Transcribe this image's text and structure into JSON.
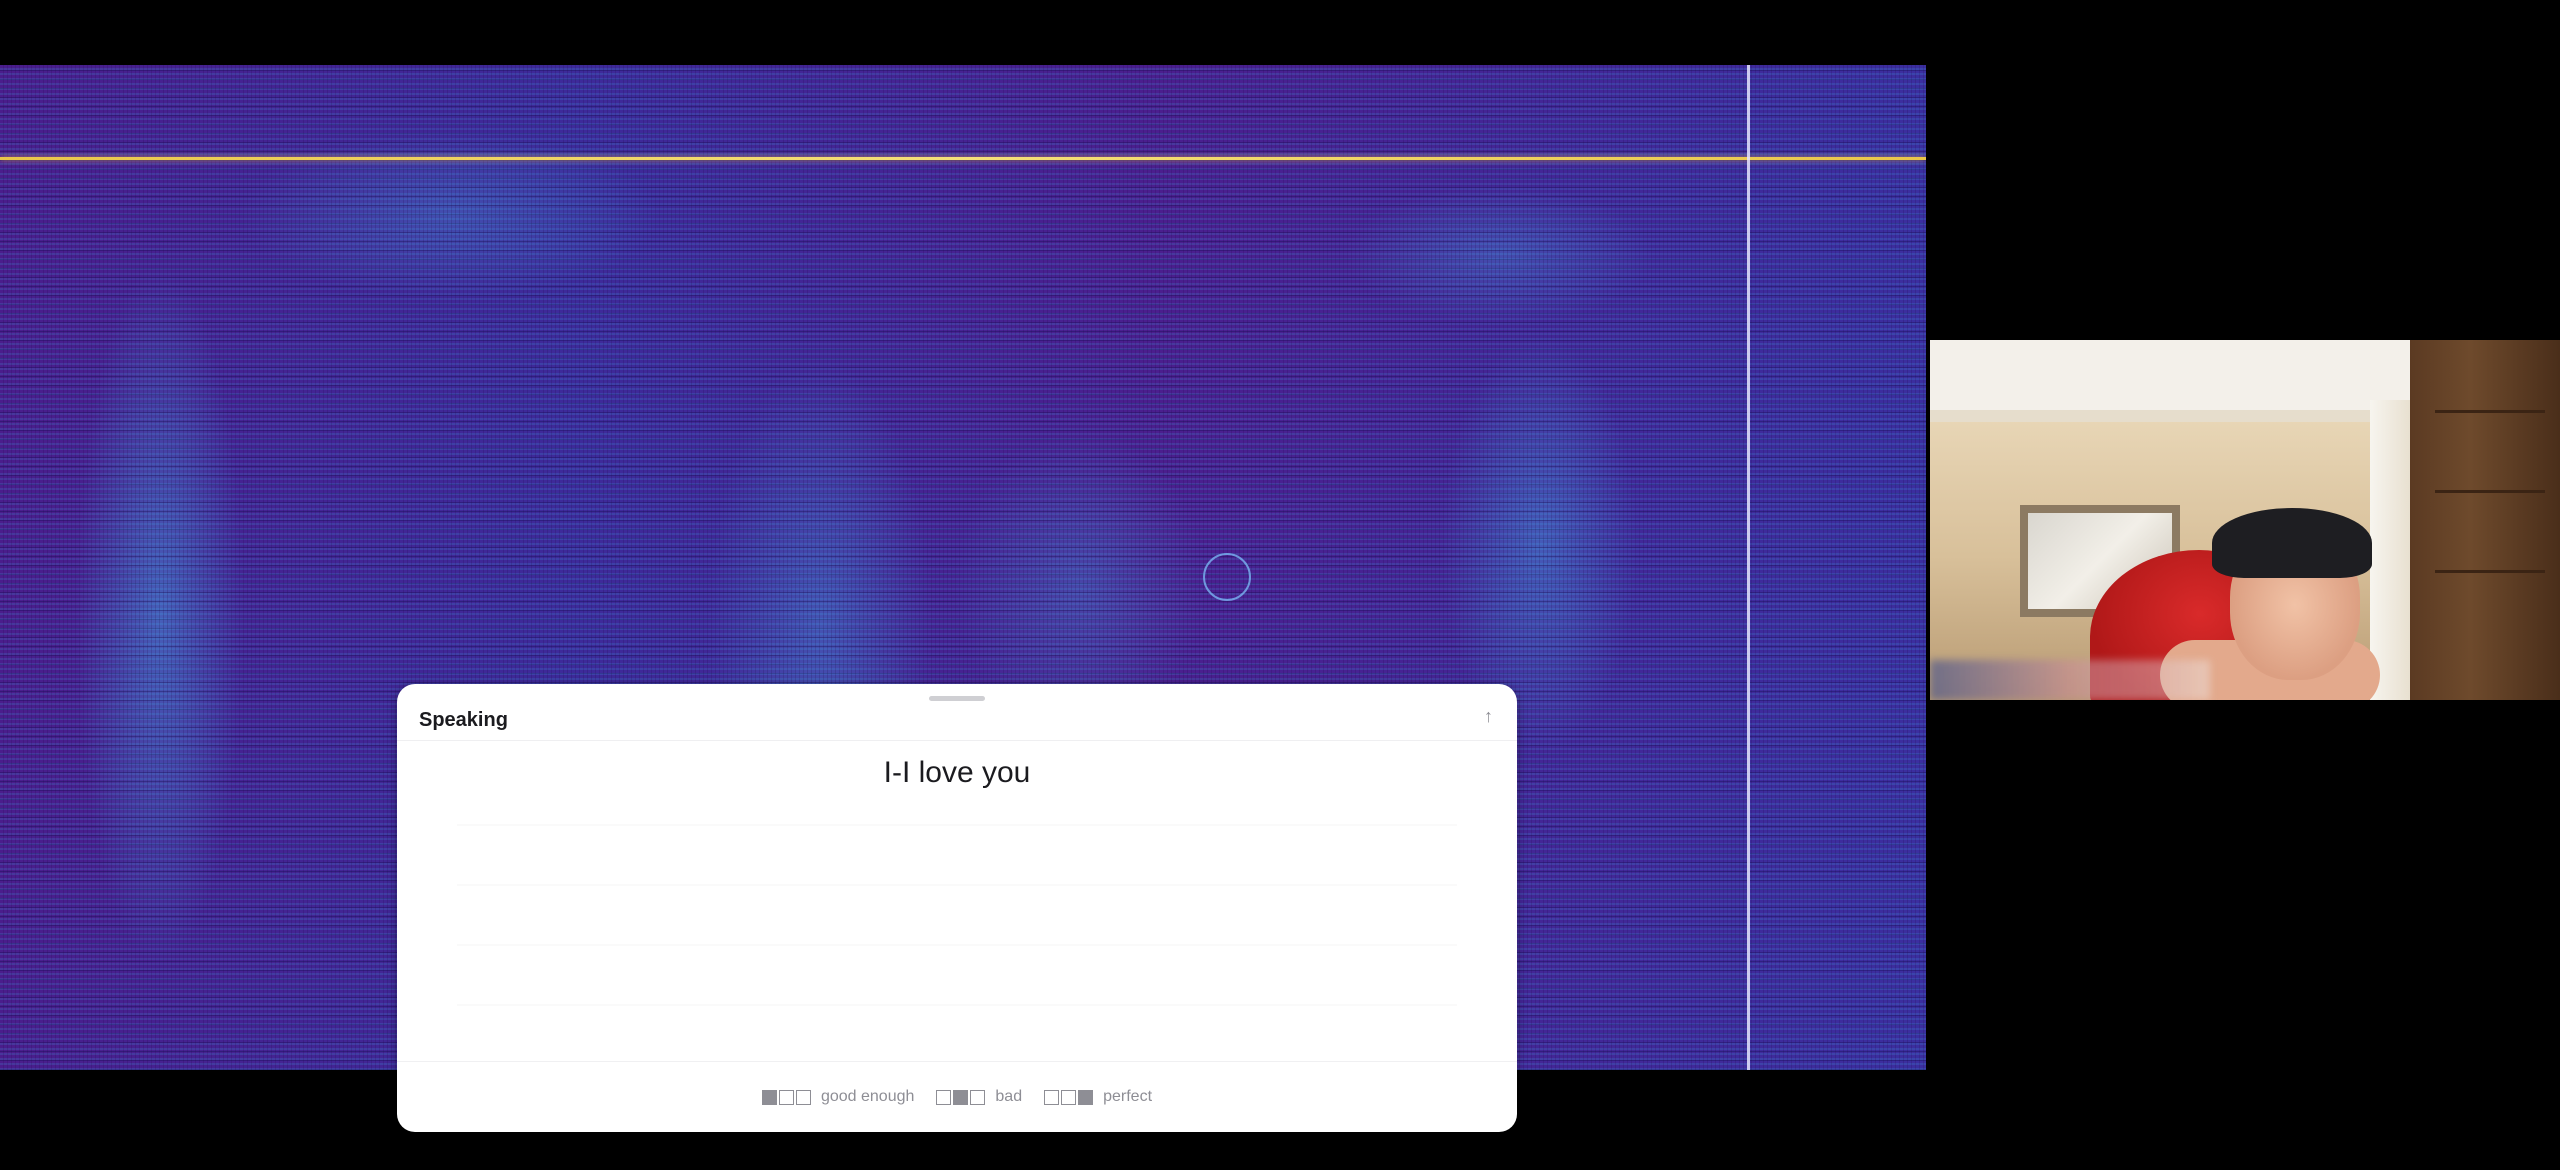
{
  "panel": {
    "title": "Speaking",
    "transcript": "I-I love you",
    "up_icon": "arrow-up-icon",
    "ratings": [
      {
        "label": "good enough",
        "icon": "rating-good-enough-icon"
      },
      {
        "label": "bad",
        "icon": "rating-bad-icon"
      },
      {
        "label": "perfect",
        "icon": "rating-perfect-icon"
      }
    ]
  },
  "colors": {
    "spectrogram_base": "#4a1d8c",
    "spectrogram_highlight": "#3cabe6",
    "frequency_line": "#f4e07a",
    "panel_background": "#ffffff",
    "muted_text": "#8e8e95"
  }
}
